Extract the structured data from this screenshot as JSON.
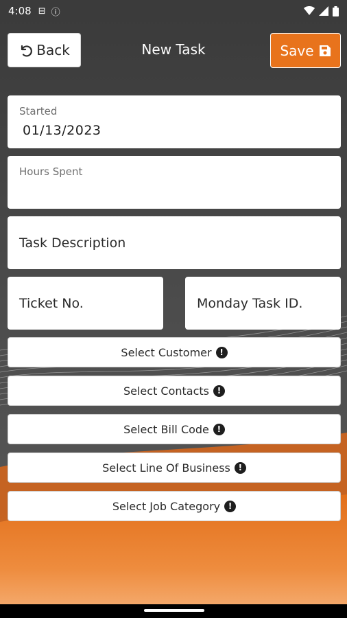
{
  "status_bar": {
    "time": "4:08",
    "icons": [
      "sim-icon",
      "info-icon"
    ],
    "right_icons": [
      "wifi-icon",
      "signal-icon",
      "battery-icon"
    ]
  },
  "header": {
    "back_label": "Back",
    "title": "New Task",
    "save_label": "Save"
  },
  "form": {
    "started_label": "Started",
    "started_value": "01/13/2023",
    "hours_label": "Hours Spent",
    "hours_value": "",
    "task_description_placeholder": "Task Description",
    "ticket_placeholder": "Ticket No.",
    "monday_task_placeholder": "Monday Task ID."
  },
  "selectors": [
    {
      "label": "Select Customer"
    },
    {
      "label": "Select Contacts"
    },
    {
      "label": "Select Bill Code"
    },
    {
      "label": "Select Line Of Business"
    },
    {
      "label": "Select Job Category"
    }
  ],
  "colors": {
    "accent": "#e8731c",
    "header_bg": "#3b3b3b",
    "background": "#4a4a4a"
  }
}
